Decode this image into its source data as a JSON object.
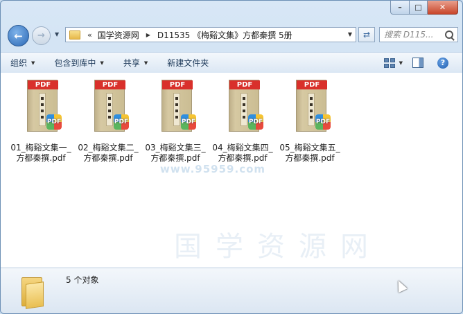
{
  "window": {
    "controls": {
      "minimize": "–",
      "maximize": "□",
      "close": "✕"
    }
  },
  "nav": {
    "back_icon": "back-arrow-icon",
    "forward_icon": "forward-arrow-icon",
    "address": {
      "prefix": "«",
      "crumbs": [
        "国学资源网",
        "D11535 《梅谿文集》方都秦撰 5册"
      ]
    },
    "search_placeholder": "搜索 D115..."
  },
  "toolbar": {
    "organize": "组织",
    "include_in_library": "包含到库中",
    "share": "共享",
    "new_folder": "新建文件夹"
  },
  "files": [
    {
      "name_line1": "01_梅谿文集一_",
      "name_line2": "方都秦撰.pdf"
    },
    {
      "name_line1": "02_梅谿文集二_",
      "name_line2": "方都秦撰.pdf"
    },
    {
      "name_line1": "03_梅谿文集三_",
      "name_line2": "方都秦撰.pdf"
    },
    {
      "name_line1": "04_梅谿文集四_",
      "name_line2": "方都秦撰.pdf"
    },
    {
      "name_line1": "05_梅谿文集五_",
      "name_line2": "方都秦撰.pdf"
    }
  ],
  "file_badge": {
    "top": "PDF",
    "corner": "PDF"
  },
  "watermark": {
    "url": "www.95959.com",
    "brand": "国学资源网"
  },
  "status": {
    "count_text": "5 个对象"
  },
  "colors": {
    "pdf_red": "#d9302b",
    "toolbar_text": "#1e3a5a",
    "window_frame": "#6b8fb5"
  }
}
